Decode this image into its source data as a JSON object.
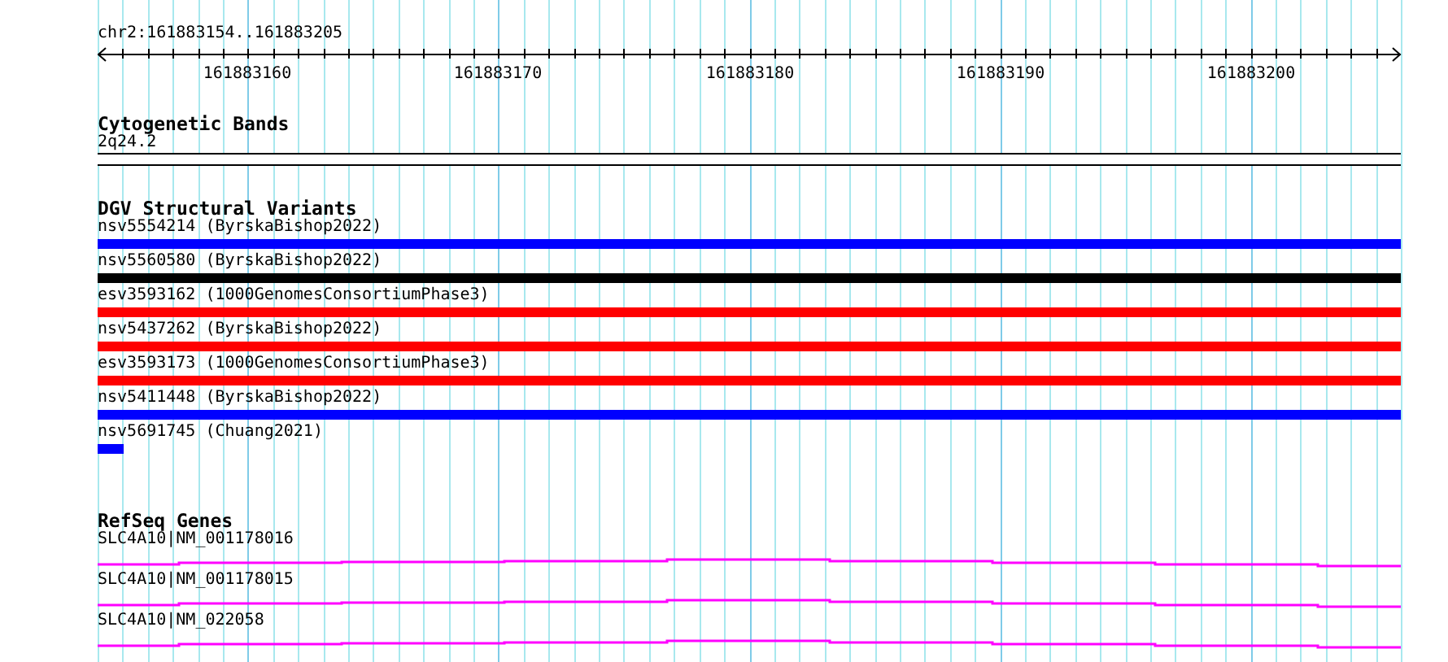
{
  "region": "chr2:161883154..161883205",
  "ruler": {
    "tick_labels": [
      "161883160",
      "161883170",
      "161883180",
      "161883190",
      "161883200"
    ]
  },
  "tracks": [
    {
      "kind": "bands",
      "title": "Cytogenetic Bands",
      "features": [
        {
          "label": "2q24.2"
        }
      ]
    },
    {
      "kind": "variants",
      "title": "DGV Structural Variants",
      "features": [
        {
          "label": "nsv5554214 (ByrskaBishop2022)",
          "color": "#0000ff",
          "kind": "full"
        },
        {
          "label": "nsv5560580 (ByrskaBishop2022)",
          "color": "#000000",
          "kind": "full"
        },
        {
          "label": "esv3593162 (1000GenomesConsortiumPhase3)",
          "color": "#ff0000",
          "kind": "full"
        },
        {
          "label": "nsv5437262 (ByrskaBishop2022)",
          "color": "#ff0000",
          "kind": "full"
        },
        {
          "label": "esv3593173 (1000GenomesConsortiumPhase3)",
          "color": "#ff0000",
          "kind": "full"
        },
        {
          "label": "nsv5411448 (ByrskaBishop2022)",
          "color": "#0000ff",
          "kind": "full"
        },
        {
          "label": "nsv5691745 (Chuang2021)",
          "color": "#0000ff",
          "kind": "partial"
        }
      ]
    },
    {
      "kind": "genes",
      "title": "RefSeq Genes",
      "features": [
        {
          "label": "SLC4A10|NM_001178016"
        },
        {
          "label": "SLC4A10|NM_001178015"
        },
        {
          "label": "SLC4A10|NM_022058"
        }
      ]
    }
  ]
}
